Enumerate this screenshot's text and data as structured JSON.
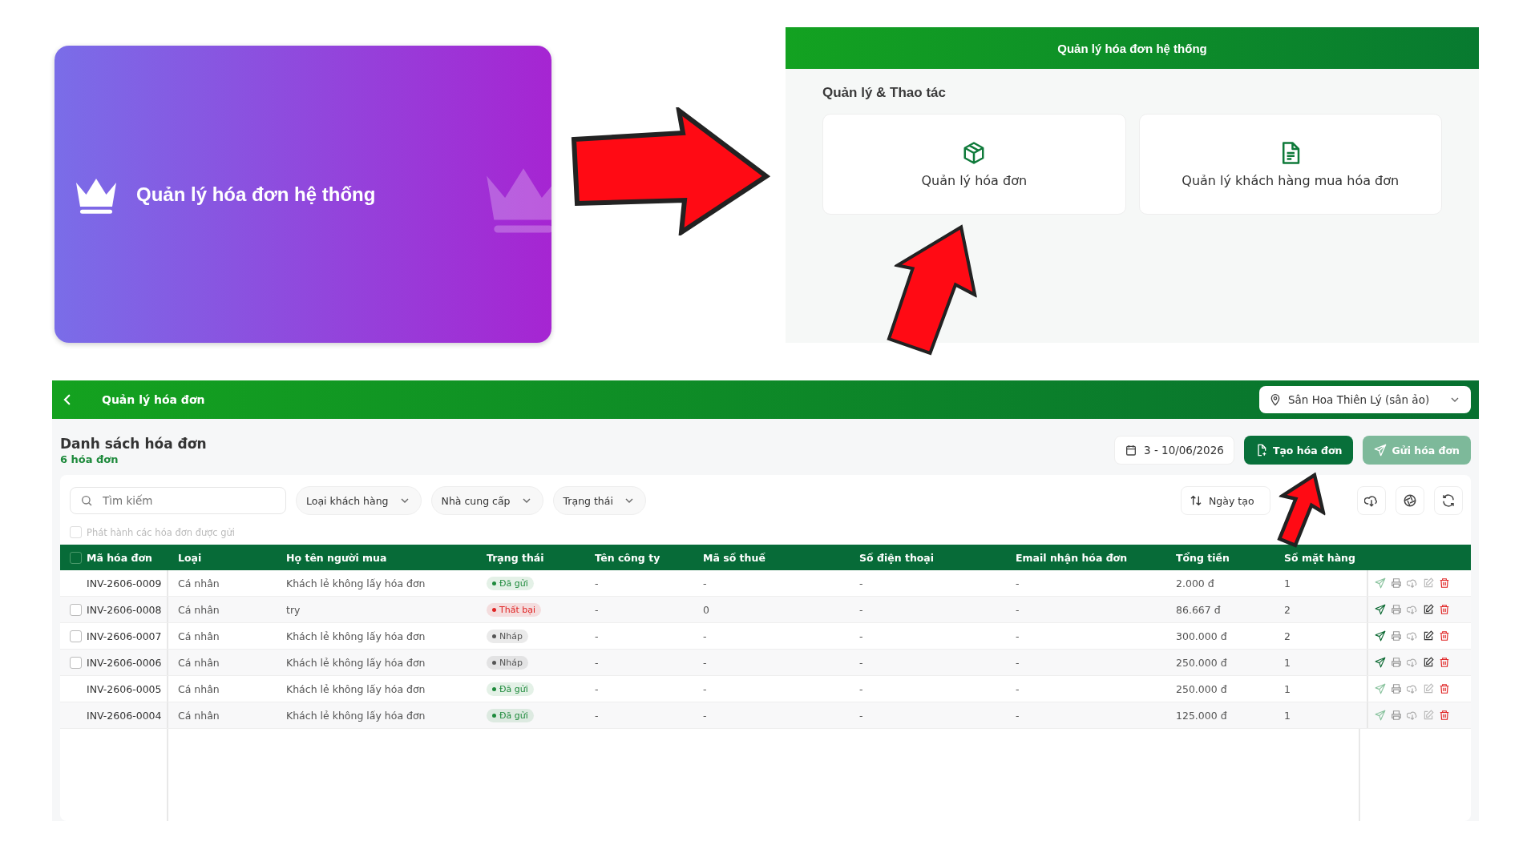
{
  "intro_card": {
    "title": "Quản lý hóa đơn hệ thống"
  },
  "menu_panel": {
    "header": "Quản lý hóa đơn hệ thống",
    "section_title": "Quản lý & Thao tác",
    "tiles": [
      {
        "kind": "box",
        "label": "Quản lý hóa đơn"
      },
      {
        "kind": "document",
        "label": "Quản lý khách hàng mua hóa đơn"
      }
    ]
  },
  "app": {
    "header": {
      "title": "Quản lý hóa đơn",
      "location": "Sân Hoa Thiên Lý (sân ảo)"
    },
    "page_title": "Danh sách hóa đơn",
    "count": "6 hóa đơn",
    "date_range": "3 - 10/06/2026",
    "buttons": [
      {
        "kind": "create",
        "label": "Tạo hóa đơn",
        "disabled": false
      },
      {
        "kind": "send",
        "label": "Gửi hóa đơn",
        "disabled": true
      }
    ],
    "search": {
      "placeholder": "Tìm kiếm"
    },
    "filters": [
      "Loại khách hàng",
      "Nhà cung cấp",
      "Trạng thái"
    ],
    "sort": {
      "label": "Ngày tạo"
    },
    "publish_option": {
      "label": "Phát hành các hóa đơn được gửi",
      "checked": false
    },
    "table": {
      "select_all_checked": false,
      "columns": [
        "Mã hóa đơn",
        "Loại",
        "Họ tên người mua",
        "Trạng thái",
        "Tên công ty",
        "Mã số thuế",
        "Số điện thoại",
        "Email nhận hóa đơn",
        "Tổng tiền",
        "Số mặt hàng"
      ],
      "rows": [
        {
          "code": "INV-2606-0009",
          "type": "Cá nhân",
          "buyer": "Khách lẻ không lấy hóa đơn",
          "status": {
            "label": "Đã gửi",
            "color": "#1e8a3c"
          },
          "company": "-",
          "tax_code": "-",
          "phone": "-",
          "email": "-",
          "total": "2.000 đ",
          "items": "1",
          "editable": false
        },
        {
          "code": "INV-2606-0008",
          "type": "Cá nhân",
          "buyer": "try",
          "status": {
            "label": "Thất bại",
            "color": "#e02424"
          },
          "company": "-",
          "tax_code": "0",
          "phone": "-",
          "email": "-",
          "total": "86.667 đ",
          "items": "2",
          "checked": false,
          "editable": true
        },
        {
          "code": "INV-2606-0007",
          "type": "Cá nhân",
          "buyer": "Khách lẻ không lấy hóa đơn",
          "status": {
            "label": "Nháp",
            "color": "#555555"
          },
          "company": "-",
          "tax_code": "-",
          "phone": "-",
          "email": "-",
          "total": "300.000 đ",
          "items": "2",
          "checked": false,
          "editable": true
        },
        {
          "code": "INV-2606-0006",
          "type": "Cá nhân",
          "buyer": "Khách lẻ không lấy hóa đơn",
          "status": {
            "label": "Nháp",
            "color": "#555555"
          },
          "company": "-",
          "tax_code": "-",
          "phone": "-",
          "email": "-",
          "total": "250.000 đ",
          "items": "1",
          "checked": false,
          "editable": true
        },
        {
          "code": "INV-2606-0005",
          "type": "Cá nhân",
          "buyer": "Khách lẻ không lấy hóa đơn",
          "status": {
            "label": "Đã gửi",
            "color": "#1e8a3c"
          },
          "company": "-",
          "tax_code": "-",
          "phone": "-",
          "email": "-",
          "total": "250.000 đ",
          "items": "1",
          "editable": false
        },
        {
          "code": "INV-2606-0004",
          "type": "Cá nhân",
          "buyer": "Khách lẻ không lấy hóa đơn",
          "status": {
            "label": "Đã gửi",
            "color": "#1e8a3c"
          },
          "company": "-",
          "tax_code": "-",
          "phone": "-",
          "email": "-",
          "total": "125.000 đ",
          "items": "1",
          "editable": false
        }
      ]
    }
  }
}
